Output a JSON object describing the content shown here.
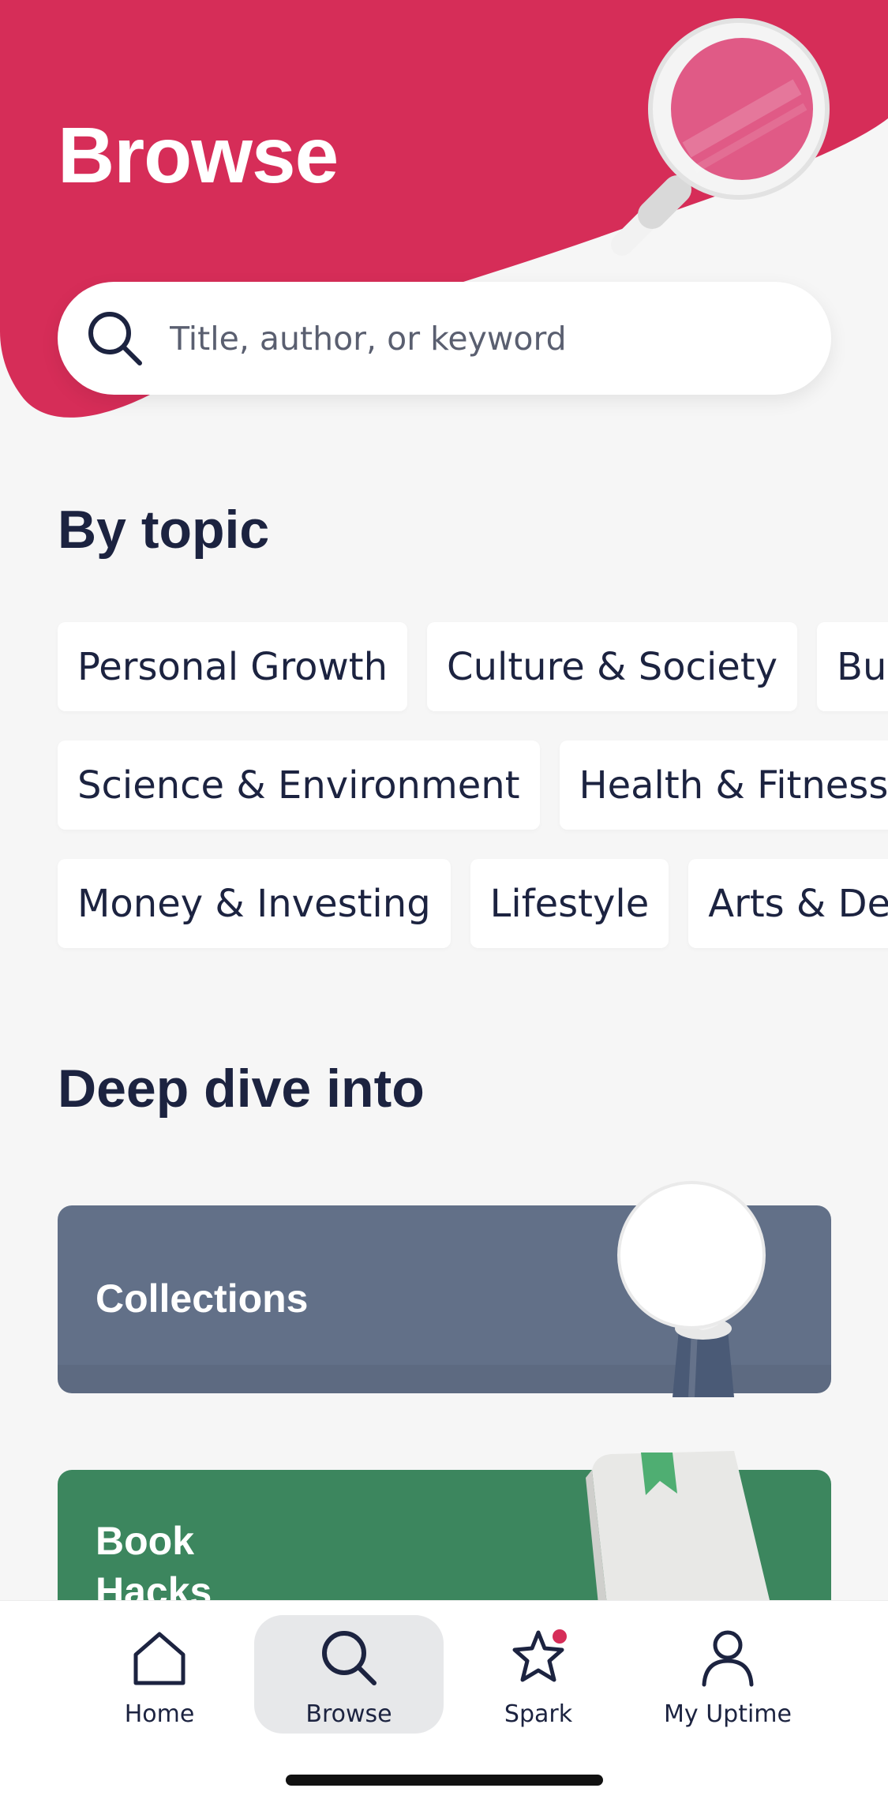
{
  "colors": {
    "brand_red": "#d62d58",
    "background": "#f6f6f6",
    "text_dark": "#1c2340",
    "collections_card": "#627088",
    "book_hacks_card": "#3c865e",
    "notification_dot": "#d62d58"
  },
  "header": {
    "title": "Browse",
    "illustration": "magnifying-glass-illustration"
  },
  "search": {
    "placeholder": "Title, author, or keyword",
    "value": "",
    "icon": "search-icon"
  },
  "by_topic": {
    "title": "By topic",
    "rows": [
      [
        "Personal Growth",
        "Culture & Society",
        "Business & Careers"
      ],
      [
        "Science & Environment",
        "Health & Fitness"
      ],
      [
        "Money & Investing",
        "Lifestyle",
        "Arts & Design"
      ]
    ]
  },
  "deep_dive": {
    "title": "Deep dive into",
    "cards": [
      {
        "label": "Collections",
        "illustration": "lightbulb-illustration"
      },
      {
        "label": "Book\nHacks",
        "illustration": "book-illustration"
      }
    ]
  },
  "bottom_nav": {
    "items": [
      {
        "label": "Home",
        "icon": "home-icon",
        "active": false
      },
      {
        "label": "Browse",
        "icon": "search-icon",
        "active": true
      },
      {
        "label": "Spark",
        "icon": "spark-icon",
        "active": false,
        "badge": true
      },
      {
        "label": "My Uptime",
        "icon": "profile-icon",
        "active": false
      }
    ]
  }
}
